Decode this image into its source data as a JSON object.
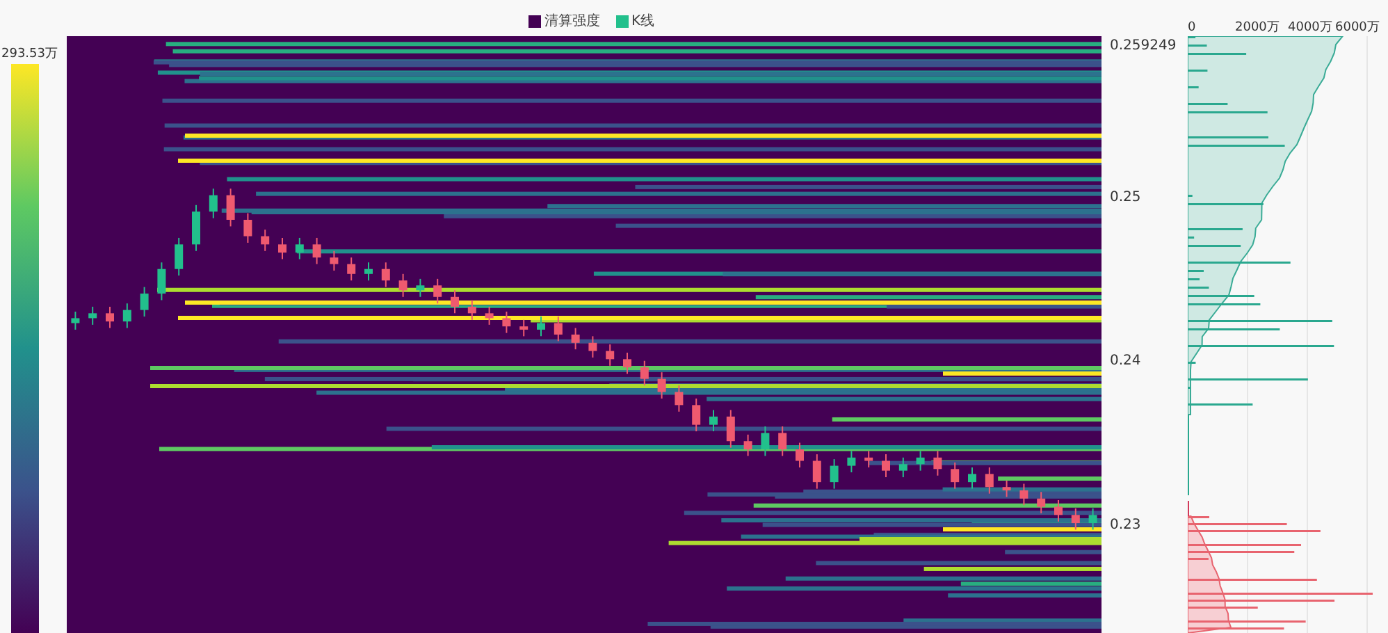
{
  "legend": [
    {
      "label": "清算强度",
      "color": "#440154"
    },
    {
      "label": "K线",
      "color": "#22c08c"
    }
  ],
  "color_scale": {
    "max_label": "293.53万"
  },
  "heatmap": {
    "chart_data": {
      "type": "candlestick",
      "ylim": [
        0.2233,
        0.2597
      ],
      "yticks": [
        0.259249,
        0.25,
        0.24,
        0.23
      ],
      "ohlc": [
        [
          0.2422,
          0.2429,
          0.2418,
          0.2425
        ],
        [
          0.2425,
          0.2432,
          0.2421,
          0.2428
        ],
        [
          0.2428,
          0.2432,
          0.2419,
          0.2423
        ],
        [
          0.2423,
          0.2434,
          0.2419,
          0.243
        ],
        [
          0.243,
          0.2444,
          0.2426,
          0.244
        ],
        [
          0.244,
          0.2459,
          0.2436,
          0.2455
        ],
        [
          0.2455,
          0.2474,
          0.2451,
          0.247
        ],
        [
          0.247,
          0.2494,
          0.2466,
          0.249
        ],
        [
          0.249,
          0.2504,
          0.2486,
          0.25
        ],
        [
          0.25,
          0.2504,
          0.2481,
          0.2485
        ],
        [
          0.2485,
          0.2489,
          0.2471,
          0.2475
        ],
        [
          0.2475,
          0.2479,
          0.2466,
          0.247
        ],
        [
          0.247,
          0.2474,
          0.2461,
          0.2465
        ],
        [
          0.2465,
          0.2474,
          0.2461,
          0.247
        ],
        [
          0.247,
          0.2474,
          0.2458,
          0.2462
        ],
        [
          0.2462,
          0.2466,
          0.2454,
          0.2458
        ],
        [
          0.2458,
          0.2462,
          0.2448,
          0.2452
        ],
        [
          0.2452,
          0.2459,
          0.2448,
          0.2455
        ],
        [
          0.2455,
          0.2459,
          0.2444,
          0.2448
        ],
        [
          0.2448,
          0.2452,
          0.2438,
          0.2442
        ],
        [
          0.2442,
          0.2449,
          0.2438,
          0.2445
        ],
        [
          0.2445,
          0.2449,
          0.2434,
          0.2438
        ],
        [
          0.2438,
          0.2442,
          0.2428,
          0.2432
        ],
        [
          0.2432,
          0.2436,
          0.2424,
          0.2428
        ],
        [
          0.2428,
          0.2432,
          0.2421,
          0.2425
        ],
        [
          0.2425,
          0.2429,
          0.2416,
          0.242
        ],
        [
          0.242,
          0.2424,
          0.2414,
          0.2418
        ],
        [
          0.2418,
          0.2426,
          0.2414,
          0.2422
        ],
        [
          0.2422,
          0.2426,
          0.2411,
          0.2415
        ],
        [
          0.2415,
          0.2419,
          0.2406,
          0.241
        ],
        [
          0.241,
          0.2414,
          0.2401,
          0.2405
        ],
        [
          0.2405,
          0.2409,
          0.2396,
          0.24
        ],
        [
          0.24,
          0.2404,
          0.2391,
          0.2395
        ],
        [
          0.2395,
          0.2399,
          0.2384,
          0.2388
        ],
        [
          0.2388,
          0.2392,
          0.2376,
          0.238
        ],
        [
          0.238,
          0.2384,
          0.2368,
          0.2372
        ],
        [
          0.2372,
          0.2376,
          0.2356,
          0.236
        ],
        [
          0.236,
          0.2369,
          0.2356,
          0.2365
        ],
        [
          0.2365,
          0.2369,
          0.2346,
          0.235
        ],
        [
          0.235,
          0.2354,
          0.2341,
          0.2345
        ],
        [
          0.2345,
          0.2359,
          0.2341,
          0.2355
        ],
        [
          0.2355,
          0.2359,
          0.2341,
          0.2345
        ],
        [
          0.2345,
          0.2349,
          0.2334,
          0.2338
        ],
        [
          0.2338,
          0.2342,
          0.2321,
          0.2325
        ],
        [
          0.2325,
          0.2339,
          0.2321,
          0.2335
        ],
        [
          0.2335,
          0.2344,
          0.2331,
          0.234
        ],
        [
          0.234,
          0.2344,
          0.2334,
          0.2338
        ],
        [
          0.2338,
          0.2342,
          0.2328,
          0.2332
        ],
        [
          0.2332,
          0.234,
          0.2328,
          0.2336
        ],
        [
          0.2336,
          0.2344,
          0.2332,
          0.234
        ],
        [
          0.234,
          0.2344,
          0.2329,
          0.2333
        ],
        [
          0.2333,
          0.2337,
          0.2321,
          0.2325
        ],
        [
          0.2325,
          0.2334,
          0.2321,
          0.233
        ],
        [
          0.233,
          0.2334,
          0.2318,
          0.2322
        ],
        [
          0.2322,
          0.2326,
          0.2316,
          0.232
        ],
        [
          0.232,
          0.2324,
          0.2311,
          0.2315
        ],
        [
          0.2315,
          0.2319,
          0.2306,
          0.231
        ],
        [
          0.231,
          0.2314,
          0.2301,
          0.2305
        ],
        [
          0.2305,
          0.2309,
          0.2296,
          0.23
        ],
        [
          0.23,
          0.2309,
          0.2296,
          0.2305
        ]
      ]
    }
  },
  "volume_axis": {
    "labels": [
      "0",
      "2000万",
      "4000万",
      "6000万"
    ]
  }
}
